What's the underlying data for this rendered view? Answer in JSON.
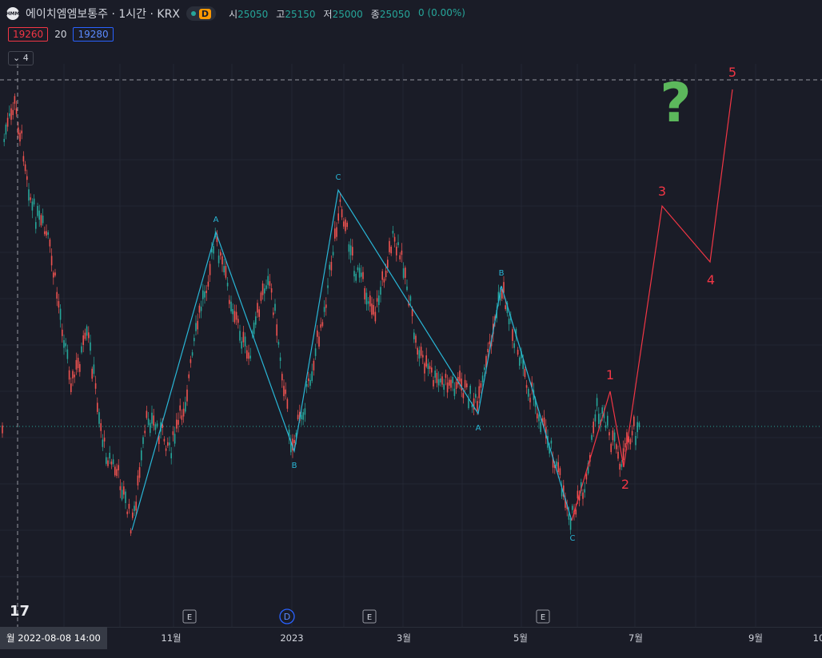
{
  "header": {
    "logo_text": "HMM",
    "title": "에이치엠엠보통주 · 1시간 · KRX",
    "interval_badge": "D",
    "ohlc": {
      "open_label": "시",
      "open": "25050",
      "high_label": "고",
      "high": "25150",
      "low_label": "저",
      "low": "25000",
      "close_label": "종",
      "close": "25050",
      "change": "0 (0.00%)"
    }
  },
  "quotes": {
    "bid": "19260",
    "spread": "20",
    "ask": "19280"
  },
  "indicators_toggle": {
    "icon": "chevron-down-icon",
    "count": "4"
  },
  "x_axis": {
    "cursor_label": "월 2022-08-08   14:00",
    "ticks": [
      "11월",
      "2023",
      "3월",
      "5월",
      "7월",
      "9월",
      "10"
    ]
  },
  "events": [
    "E",
    "D",
    "E",
    "E"
  ],
  "chart_data": {
    "type": "candlestick",
    "instrument": "에이치엠엠보통주",
    "interval": "1시간",
    "exchange": "KRX",
    "price_scale": "hidden",
    "wave_labels": {
      "corrective": [
        "A",
        "B",
        "C",
        "A",
        "B",
        "C"
      ],
      "impulse": [
        "1",
        "2",
        "3",
        "4",
        "5"
      ],
      "question_mark": "?"
    },
    "colors": {
      "up": "#26a69a",
      "down": "#ef5350",
      "waves": "#29b6d6",
      "impulse": "#f23645",
      "question": "#5cb85c"
    }
  }
}
